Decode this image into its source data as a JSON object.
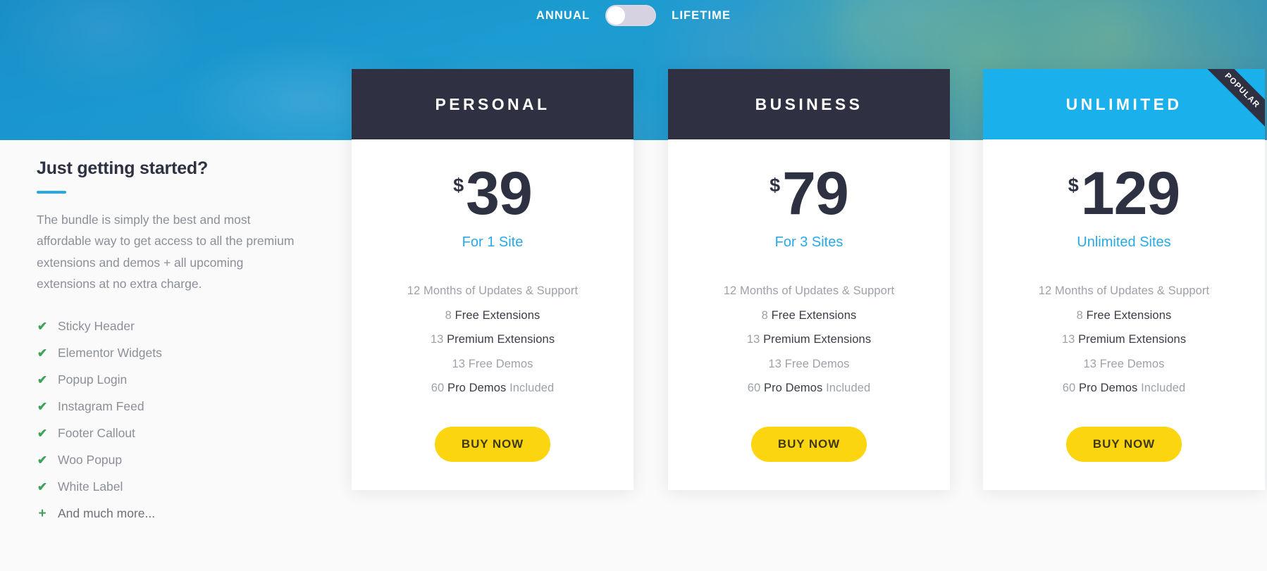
{
  "toggle": {
    "left_label": "ANNUAL",
    "right_label": "LIFETIME",
    "state": "annual",
    "knob_icon": "toggle-knob"
  },
  "left_panel": {
    "title": "Just getting started?",
    "description": "The bundle is simply the best and most affordable way to get access to all the premium extensions and demos + all upcoming extensions at no extra charge.",
    "features": [
      {
        "icon": "check-icon",
        "label": "Sticky Header"
      },
      {
        "icon": "check-icon",
        "label": "Elementor Widgets"
      },
      {
        "icon": "check-icon",
        "label": "Popup Login"
      },
      {
        "icon": "check-icon",
        "label": "Instagram Feed"
      },
      {
        "icon": "check-icon",
        "label": "Footer Callout"
      },
      {
        "icon": "check-icon",
        "label": "Woo Popup"
      },
      {
        "icon": "check-icon",
        "label": "White Label"
      },
      {
        "icon": "plus-icon",
        "label": "And much more..."
      }
    ]
  },
  "plans": [
    {
      "name": "PERSONAL",
      "currency": "$",
      "price": "39",
      "sites": "For 1 Site",
      "badge": null,
      "features": {
        "updates_num": "12",
        "updates_text": "Months of Updates & Support",
        "free_ext_num": "8",
        "free_ext_text": "Free Extensions",
        "premium_ext_num": "13",
        "premium_ext_text": "Premium Extensions",
        "free_demos_num": "13",
        "free_demos_text": "Free Demos",
        "pro_demos_num": "60",
        "pro_demos_text": "Pro Demos",
        "pro_demos_suffix": "Included"
      },
      "cta": "BUY NOW"
    },
    {
      "name": "BUSINESS",
      "currency": "$",
      "price": "79",
      "sites": "For 3 Sites",
      "badge": null,
      "features": {
        "updates_num": "12",
        "updates_text": "Months of Updates & Support",
        "free_ext_num": "8",
        "free_ext_text": "Free Extensions",
        "premium_ext_num": "13",
        "premium_ext_text": "Premium Extensions",
        "free_demos_num": "13",
        "free_demos_text": "Free Demos",
        "pro_demos_num": "60",
        "pro_demos_text": "Pro Demos",
        "pro_demos_suffix": "Included"
      },
      "cta": "BUY NOW"
    },
    {
      "name": "UNLIMITED",
      "currency": "$",
      "price": "129",
      "sites": "Unlimited Sites",
      "badge": "POPULAR",
      "features": {
        "updates_num": "12",
        "updates_text": "Months of Updates & Support",
        "free_ext_num": "8",
        "free_ext_text": "Free Extensions",
        "premium_ext_num": "13",
        "premium_ext_text": "Premium Extensions",
        "free_demos_num": "13",
        "free_demos_text": "Free Demos",
        "pro_demos_num": "60",
        "pro_demos_text": "Pro Demos",
        "pro_demos_suffix": "Included"
      },
      "cta": "BUY NOW"
    }
  ],
  "colors": {
    "header_dark": "#2f3143",
    "header_highlight": "#19b0ec",
    "accent_blue": "#29a8e8",
    "cta_yellow": "#fcd511",
    "check_green": "#3fa15a",
    "text_dark": "#2e3142",
    "text_muted": "#8b8f98"
  }
}
